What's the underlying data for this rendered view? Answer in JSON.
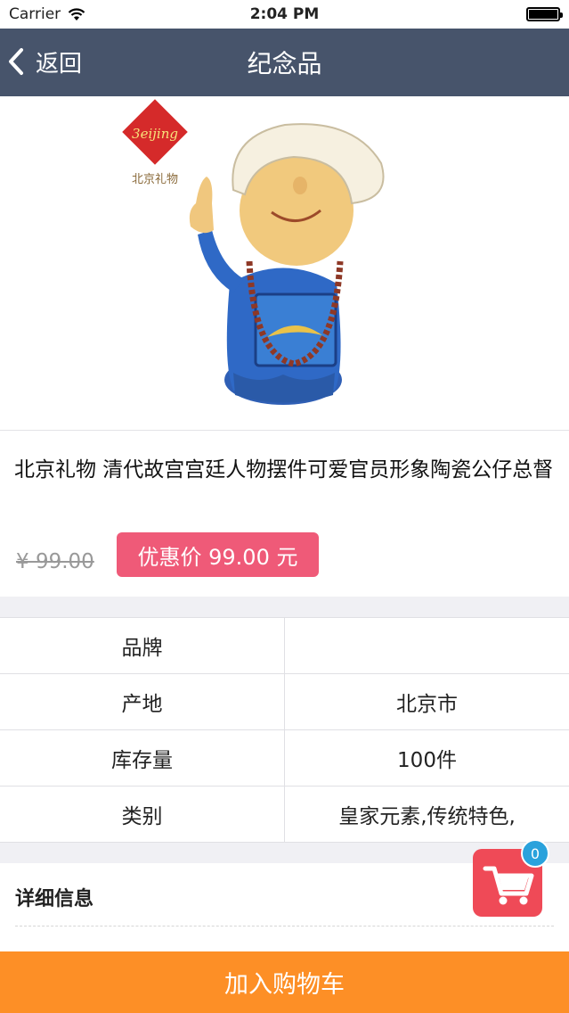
{
  "status_bar": {
    "carrier": "Carrier",
    "time": "2:04 PM"
  },
  "nav": {
    "back_label": "返回",
    "title": "纪念品"
  },
  "product": {
    "title": "北京礼物 清代故宫宫廷人物摆件可爱官员形象陶瓷公仔总督",
    "original_price": "¥ 99.00",
    "sale_price": "优惠价 99.00 元",
    "logo_text": "北京礼物"
  },
  "specs": [
    {
      "key": "品牌",
      "value": ""
    },
    {
      "key": "产地",
      "value": "北京市"
    },
    {
      "key": "库存量",
      "value": "100件"
    },
    {
      "key": "类别",
      "value": "皇家元素,传统特色,"
    }
  ],
  "detail": {
    "title": "详细信息"
  },
  "cart": {
    "badge_count": "0",
    "add_label": "加入购物车"
  },
  "colors": {
    "nav_bg": "#47546b",
    "sale_badge": "#ef5a78",
    "add_cart_bg": "#fd8f26",
    "cart_fab": "#ef4a57",
    "badge": "#2aa2dc"
  }
}
